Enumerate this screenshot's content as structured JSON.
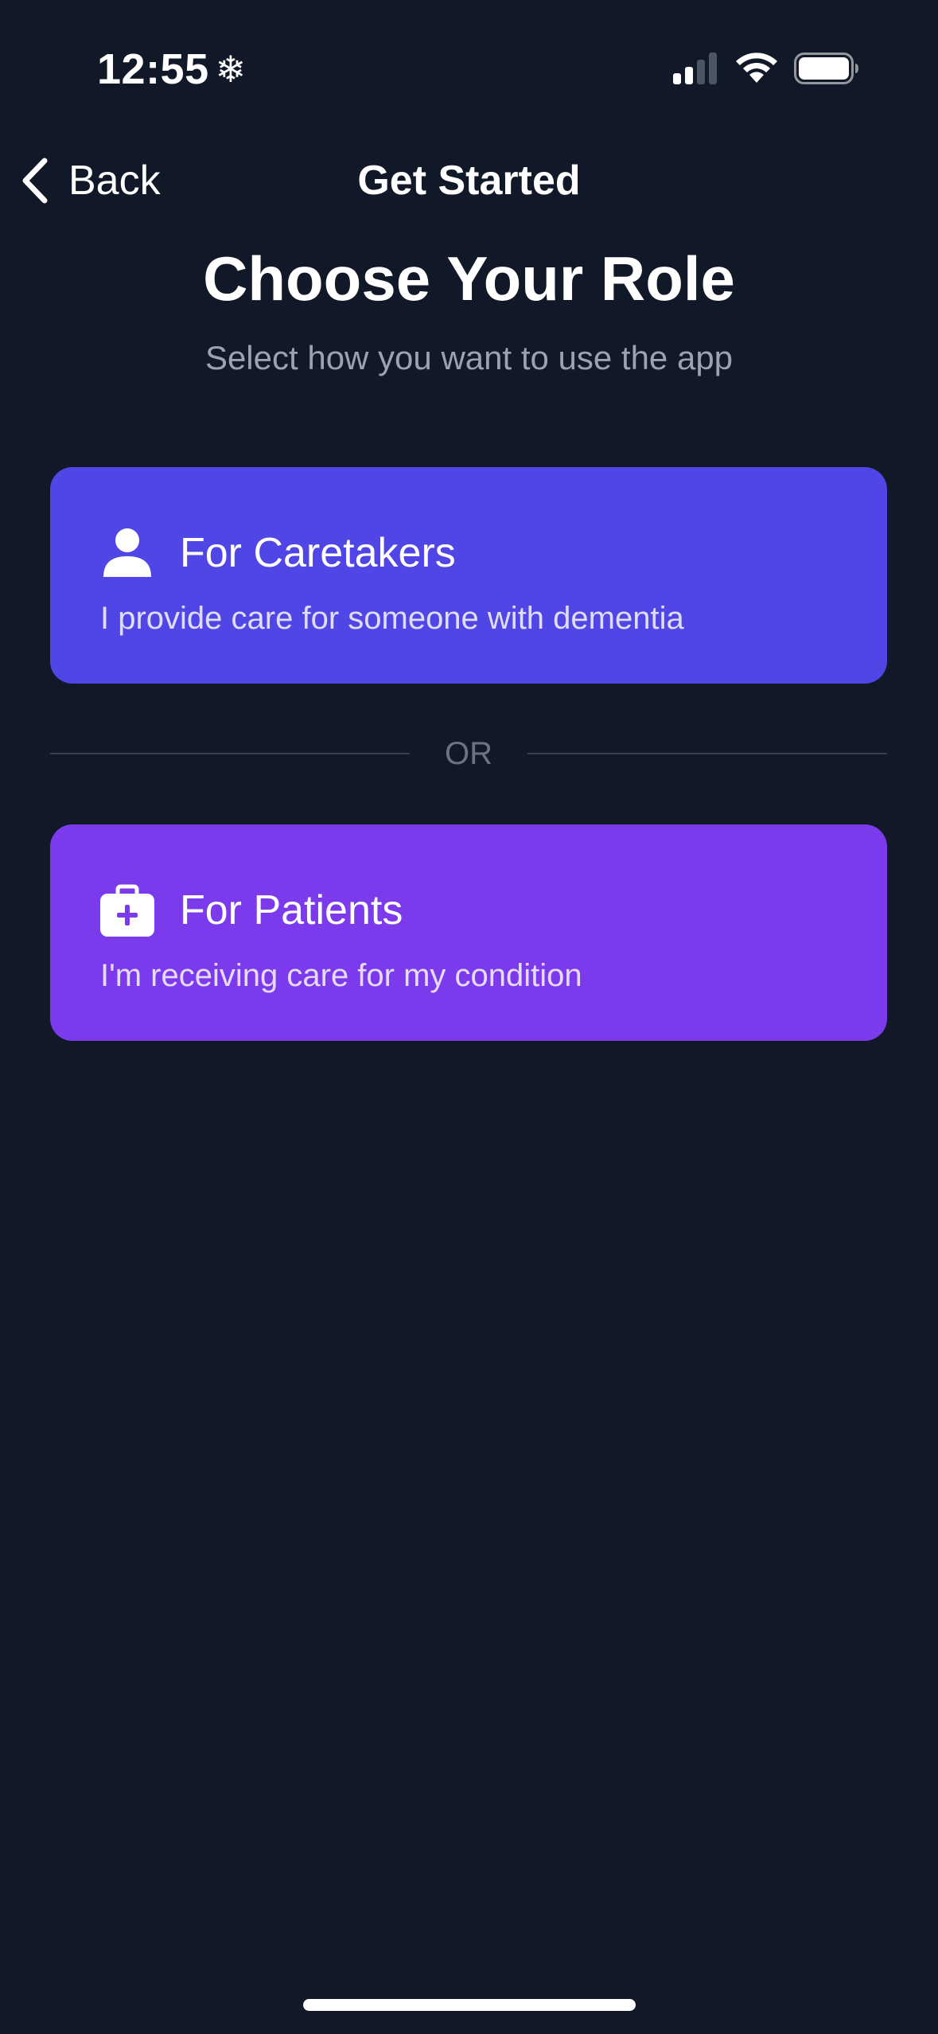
{
  "status_bar": {
    "time": "12:55",
    "mode_icon": "snowflake-icon",
    "signal_icon": "cellular-signal-icon",
    "wifi_icon": "wifi-icon",
    "battery_icon": "battery-icon"
  },
  "nav": {
    "back_label": "Back",
    "back_icon": "chevron-left-icon",
    "title": "Get Started"
  },
  "header": {
    "title": "Choose Your Role",
    "subtitle": "Select how you want to use the app"
  },
  "roles": [
    {
      "title": "For Caretakers",
      "description": "I provide care for someone with dementia",
      "icon": "person-icon",
      "color": "#4f46e5"
    },
    {
      "title": "For Patients",
      "description": "I'm receiving care for my condition",
      "icon": "medical-kit-icon",
      "color": "#7c3aed"
    }
  ],
  "divider": {
    "label": "OR"
  },
  "colors": {
    "background": "#111827",
    "subtitle": "#9ca3af",
    "divider_line": "#374151",
    "divider_text": "#6b7280"
  }
}
